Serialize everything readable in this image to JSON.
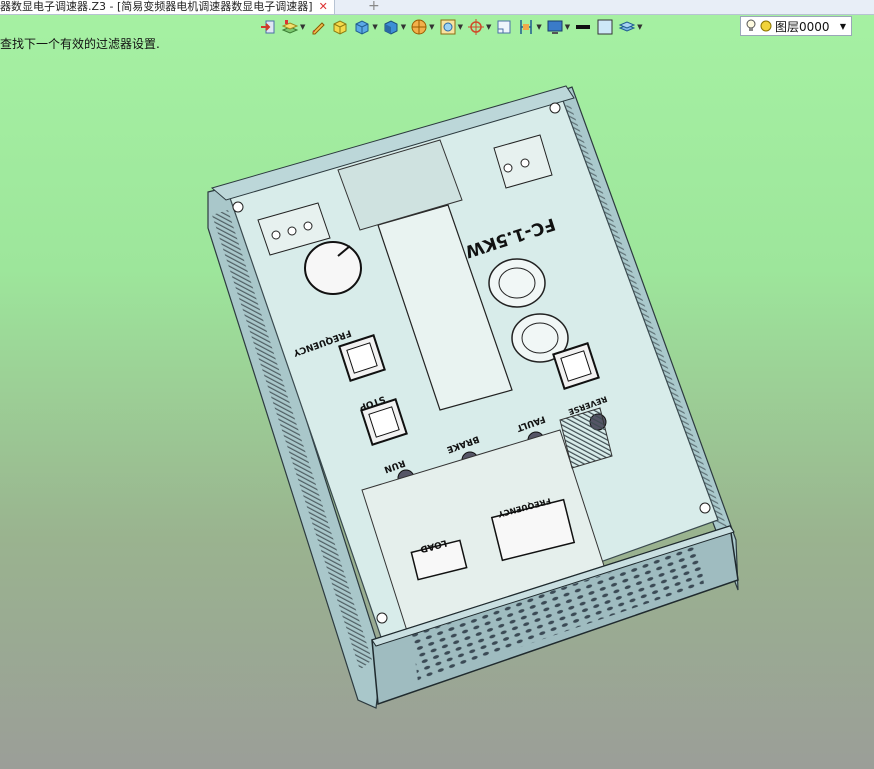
{
  "tab": {
    "title": "器数显电子调速器.Z3 - [简易变频器电机调速器数显电子调速器]",
    "close": "✕",
    "new": "+"
  },
  "status": {
    "message": "查找下一个有效的过滤器设置."
  },
  "toolbar": {
    "items": [
      {
        "icon": "import-icon"
      },
      {
        "icon": "layer-stack-icon",
        "dropdown": true
      },
      {
        "icon": "pencil-icon"
      },
      {
        "icon": "cube-yellow-icon"
      },
      {
        "icon": "cube-blue-icon",
        "dropdown": true
      },
      {
        "icon": "render-cube-icon",
        "dropdown": true
      },
      {
        "icon": "section-view-icon",
        "dropdown": true
      },
      {
        "icon": "frame-view-icon",
        "dropdown": true
      },
      {
        "icon": "compass-icon",
        "dropdown": true
      },
      {
        "icon": "grid-icon"
      },
      {
        "icon": "align-icon",
        "dropdown": true
      },
      {
        "icon": "monitor-icon",
        "dropdown": true
      },
      {
        "icon": "line-weight-icon"
      },
      {
        "icon": "color-swatch-icon"
      },
      {
        "icon": "layers-icon",
        "dropdown": true
      }
    ]
  },
  "layer": {
    "name": "图层0000",
    "colors": {
      "bulb": "#f3d84b",
      "circle": "#e7c400"
    }
  },
  "model": {
    "labels": {
      "model_name": "FC-1.5KW",
      "frequency_knob": "FREQUENCY",
      "stop": "STOP",
      "run": "RUN",
      "brake": "BRAKE",
      "fault": "FAULT",
      "reverse": "REVERSE",
      "frequency_display": "FREQUENCY",
      "load": "LOAD"
    }
  }
}
